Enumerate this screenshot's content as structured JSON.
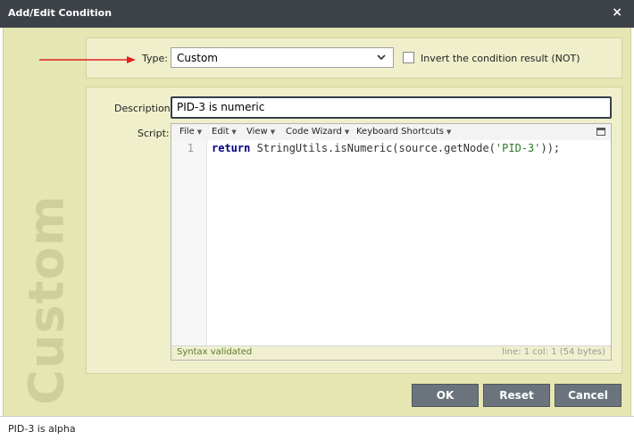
{
  "window": {
    "title": "Add/Edit Condition",
    "close_glyph": "×"
  },
  "watermark": "Custom",
  "type_row": {
    "label": "Type:",
    "selected": "Custom",
    "invert_label": "Invert the condition result (NOT)",
    "invert_checked": false
  },
  "description": {
    "label": "Description:",
    "value": "PID-3 is numeric"
  },
  "script": {
    "label": "Script:",
    "toolbar": [
      "File",
      "Edit",
      "View",
      "Code Wizard",
      "Keyboard Shortcuts"
    ],
    "line_number": "1",
    "code": {
      "keyword": "return",
      "before_string": " StringUtils.isNumeric(source.getNode(",
      "string": "'PID-3'",
      "after_string": "));"
    },
    "status": "Syntax validated",
    "position": "line: 1  col: 1  (54 bytes)"
  },
  "buttons": {
    "ok": "OK",
    "reset": "Reset",
    "cancel": "Cancel"
  },
  "footer": {
    "text": "PID-3 is alpha"
  },
  "colors": {
    "title_bar": "#3d4249",
    "dialog_bg": "#e6e6b3",
    "button": "#6b747d",
    "arrow": "#e02020"
  }
}
